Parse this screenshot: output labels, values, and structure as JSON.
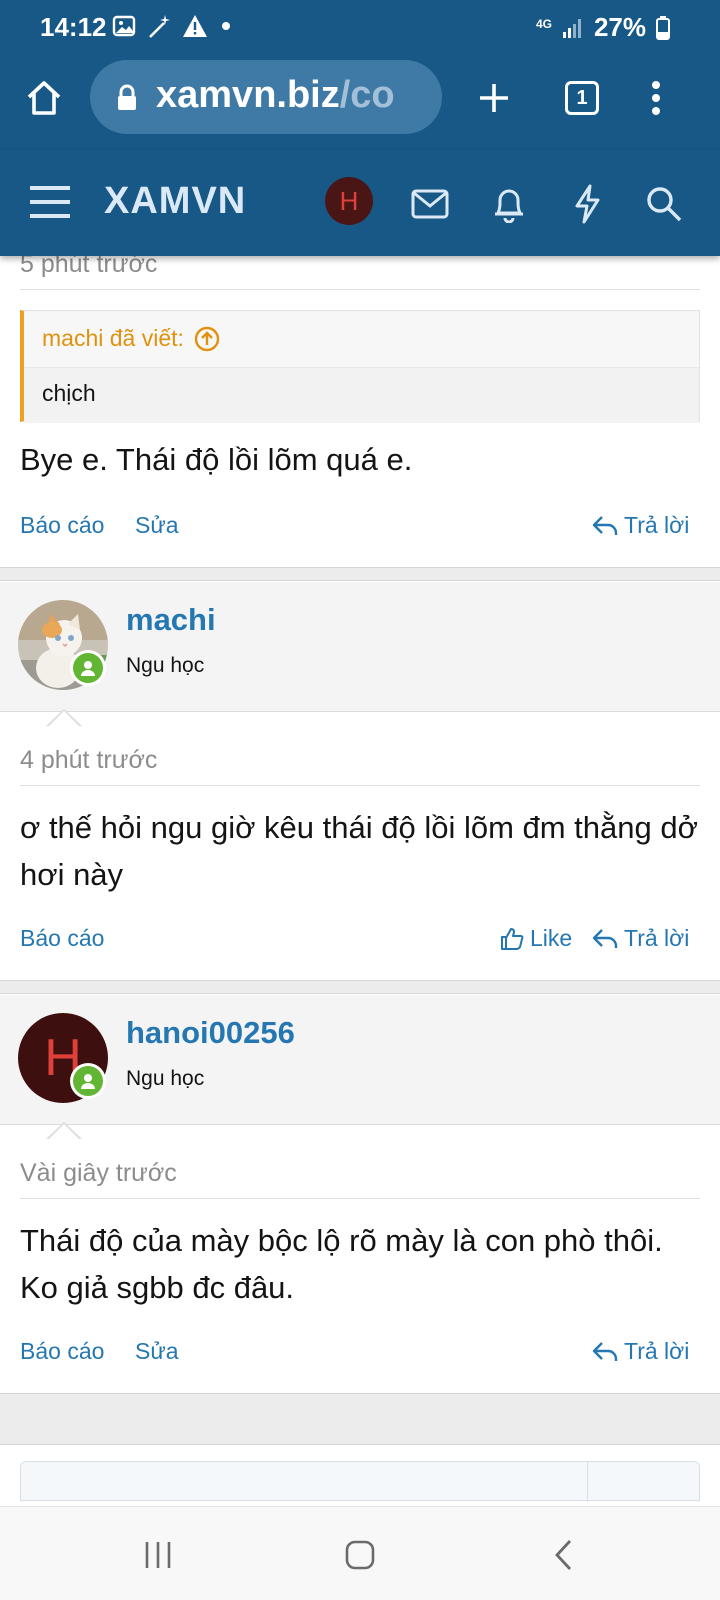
{
  "status_bar": {
    "time": "14:12",
    "network": "4G",
    "battery": "27%"
  },
  "browser": {
    "url_domain": "xamvn.biz",
    "url_path": "/co",
    "tab_count": "1"
  },
  "site": {
    "logo": "XAMVN",
    "user_initial": "H"
  },
  "top_post": {
    "time": "5 phút trước",
    "quote_author": "machi đã viết:",
    "quote_text": "chịch",
    "text": "Bye e. Thái độ lồi lõm quá e.",
    "report": "Báo cáo",
    "edit": "Sửa",
    "reply": "Trả lời"
  },
  "posts": [
    {
      "username": "machi",
      "user_title": "Ngu học",
      "time": "4 phút trước",
      "text": "ơ thế hỏi ngu giờ kêu thái độ lồi lõm đm thằng dở hơi này",
      "report": "Báo cáo",
      "like": "Like",
      "reply": "Trả lời"
    },
    {
      "username": "hanoi00256",
      "avatar_initial": "H",
      "user_title": "Ngu học",
      "time": "Vài giây trước",
      "text": "Thái độ của mày bộc lộ rõ mày là con phò thôi. Ko giả sgbb đc đâu.",
      "report": "Báo cáo",
      "edit": "Sửa",
      "reply": "Trả lời"
    }
  ],
  "colors": {
    "header": "#185886",
    "link": "#2577b1",
    "quote_accent": "#f0a020",
    "online": "#63b634"
  }
}
